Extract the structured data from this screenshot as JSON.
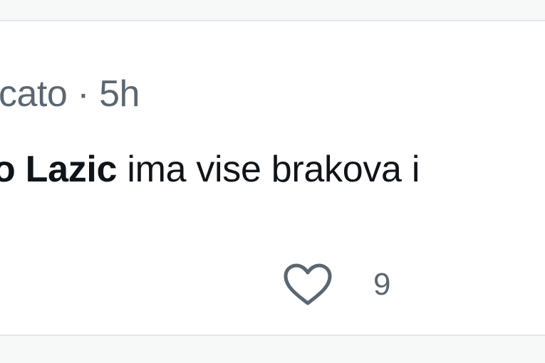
{
  "comment": {
    "author_partial": "cato",
    "separator": "·",
    "timestamp": "5h",
    "mention": "o Lazic",
    "text": " ima vise brakova i",
    "likes": "9",
    "like_icon": "heart-icon"
  },
  "colors": {
    "background": "#ffffff",
    "muted_text": "#5b6770",
    "primary_text": "#0f1419",
    "divider": "#e3e7ea"
  }
}
